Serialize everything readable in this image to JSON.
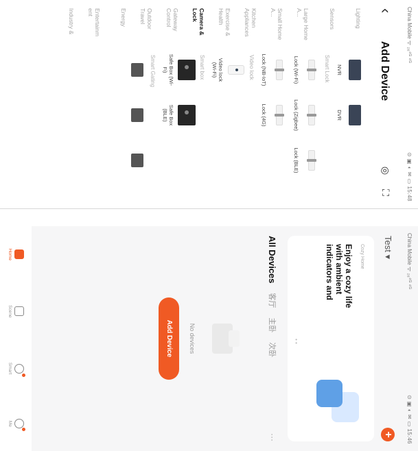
{
  "add_device": {
    "status": {
      "left": "China Mobile  ᯤ  ₂₆⁴ᴳ  ⁴ᴳ",
      "right": "⊙ ▣ ◐ ✉ ▭  15:48"
    },
    "back_glyph": "‹",
    "title": "Add Device",
    "categories": [
      {
        "label": "Lighting"
      },
      {
        "label": "Sensors"
      },
      {
        "label": "Large Home A..."
      },
      {
        "label": "Small Home A..."
      },
      {
        "label": "Kitchen Appliances"
      },
      {
        "label": "Exercise & Health"
      },
      {
        "label": "Camera & Lock",
        "active": true
      },
      {
        "label": "Gateway Control"
      },
      {
        "label": "Outdoor Travel"
      },
      {
        "label": "Energy"
      },
      {
        "label": "Entertainm ent"
      },
      {
        "label": "Industry &"
      }
    ],
    "top_devices": [
      "NVR",
      "DVR"
    ],
    "smart_lock": {
      "section": "Smart Lock",
      "devices": [
        "Lock (Wi-Fi)",
        "Lock (Zigbee)",
        "Lock (BLE)",
        "Lock (NB-IoT)",
        "Lock (4G)"
      ]
    },
    "video_lock": {
      "section": "Video lock",
      "devices": [
        "Video lock (Wi-Fi)"
      ]
    },
    "smart_box": {
      "section": "Smart box",
      "devices": [
        "Safe Box (Wi-Fi)",
        "Safe Box (BLE)"
      ]
    },
    "smart_gating": {
      "section": "Smart Gating"
    }
  },
  "home": {
    "status": {
      "left": "China Mobile  ᯤ  ₂₆⁴ᴳ  ⁴ᴳ",
      "right": "⊙ ▣ ◐ ✉ ▭  15:46"
    },
    "home_name": "Test ▾",
    "plus": "+",
    "banner": {
      "kicker": "Cozy Home",
      "text": "Enjoy a cozy life with ambient indicators and"
    },
    "tabs": [
      "All Devices",
      "客厅",
      "主卧",
      "次卧"
    ],
    "more": "···",
    "empty_text": "No devices",
    "add_button": "Add Device",
    "nav": [
      {
        "label": "Home",
        "active": true
      },
      {
        "label": "Scene"
      },
      {
        "label": "Smart",
        "dot": true
      },
      {
        "label": "Me",
        "dot": true
      }
    ]
  }
}
